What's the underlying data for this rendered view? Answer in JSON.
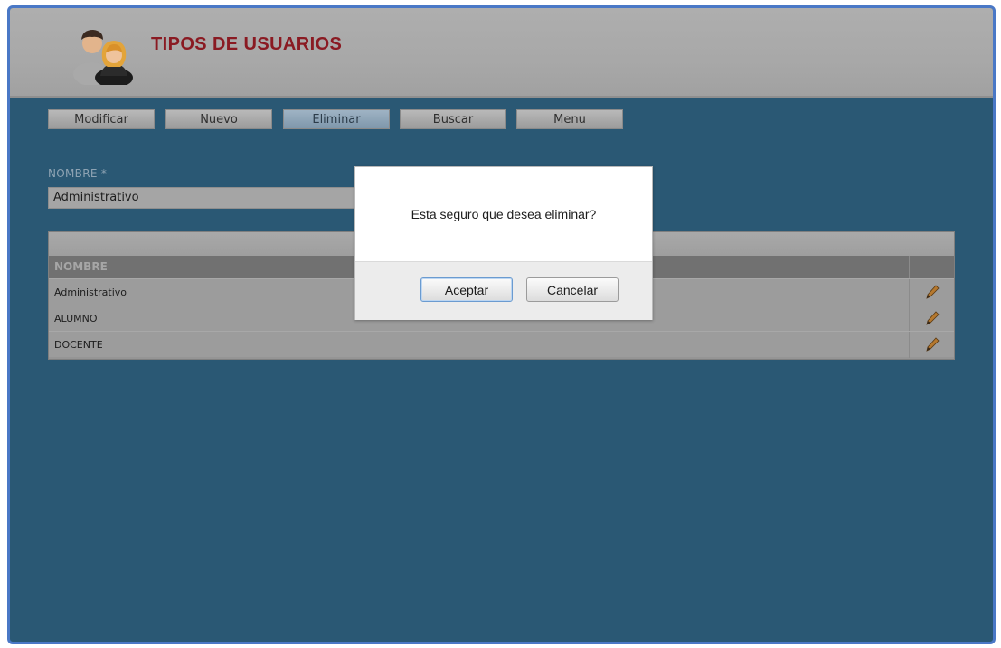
{
  "header": {
    "title": "TIPOS DE USUARIOS",
    "logo_icon": "users-icon"
  },
  "toolbar": {
    "buttons": [
      {
        "label": "Modificar"
      },
      {
        "label": "Nuevo"
      },
      {
        "label": "Eliminar",
        "active": true
      },
      {
        "label": "Buscar"
      },
      {
        "label": "Menu"
      }
    ]
  },
  "form": {
    "nombre_label": "NOMBRE *",
    "nombre_value": "Administrativo"
  },
  "table": {
    "column_header": "NOMBRE",
    "edit_icon": "pencil-icon",
    "rows": [
      {
        "name": "Administrativo"
      },
      {
        "name": "ALUMNO"
      },
      {
        "name": "DOCENTE"
      }
    ]
  },
  "dialog": {
    "message": "Esta seguro que desea eliminar?",
    "accept_label": "Aceptar",
    "cancel_label": "Cancelar"
  },
  "colors": {
    "background": "#2a5874",
    "title": "#8a1a22",
    "frame_border": "#4a78c6"
  }
}
